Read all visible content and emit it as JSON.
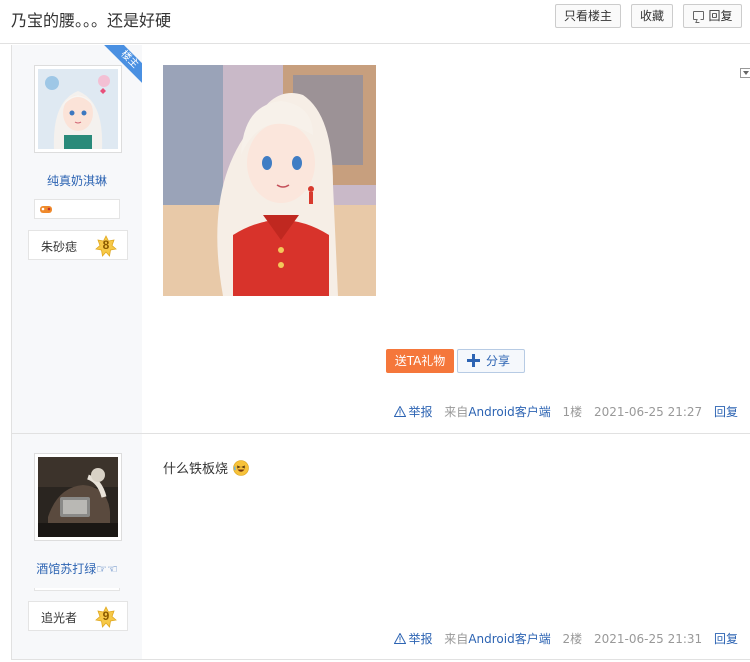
{
  "thread": {
    "title": "乃宝的腰。。。还是好硬",
    "buttons": {
      "only_owner": "只看楼主",
      "favorite": "收藏",
      "reply": "回复"
    }
  },
  "posts": [
    {
      "author": {
        "name": "纯真奶淇琳",
        "level_name": "朱砂痣",
        "level": "8",
        "owner_tag": "楼主"
      },
      "gift_label": "送TA礼物",
      "share_label": "分享",
      "meta": {
        "report": "举报",
        "source_prefix": "来自",
        "source_client": "Android客户端",
        "floor": "1楼",
        "time": "2021-06-25 21:27",
        "reply": "回复"
      }
    },
    {
      "author": {
        "name": "酒馆苏打绿☞☜",
        "level_name": "追光者",
        "level": "9"
      },
      "text": "什么铁板烧",
      "meta": {
        "report": "举报",
        "source_prefix": "来自",
        "source_client": "Android客户端",
        "floor": "2楼",
        "time": "2021-06-25 21:31",
        "reply": "回复"
      }
    }
  ],
  "colors": {
    "link": "#2d64b3",
    "gift": "#f5773b",
    "owner_tag": "#4a90e2"
  }
}
